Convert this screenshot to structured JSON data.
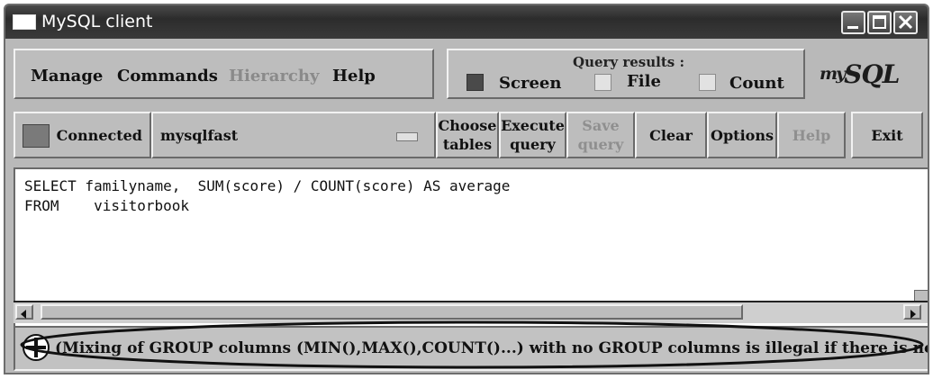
{
  "window": {
    "title": "MySQL client"
  },
  "menu": {
    "manage": "Manage",
    "commands": "Commands",
    "hierarchy": "Hierarchy",
    "help": "Help"
  },
  "query_results": {
    "label": "Query results :",
    "screen": "Screen",
    "file": "File",
    "count": "Count",
    "screen_checked": true,
    "file_checked": false,
    "count_checked": false
  },
  "logo": {
    "my": "my",
    "sql": "SQL"
  },
  "toolbar": {
    "connected": "Connected",
    "database": "mysqlfast",
    "choose_tables_1": "Choose",
    "choose_tables_2": "tables",
    "execute_query_1": "Execute",
    "execute_query_2": "query",
    "save_query_1": "Save",
    "save_query_2": "query",
    "clear": "Clear",
    "options": "Options",
    "help": "Help",
    "exit": "Exit"
  },
  "editor": {
    "line1": "SELECT familyname,  SUM(score) / COUNT(score) AS average",
    "line2": "FROM    visitorbook"
  },
  "status": {
    "message": "(Mixing of GROUP columns (MIN(),MAX(),COUNT()...) with no GROUP columns is illegal if there is no GROUP BY clause) Info"
  },
  "colors": {
    "window_bg": "#b9b9b9",
    "titlebar": "#2c2c2c",
    "status_checked": "#4a4a4a"
  },
  "icons": {
    "app": "window-icon",
    "minimize": "minimize-icon",
    "maximize": "maximize-icon",
    "close": "close-icon",
    "status": "crosshair-icon"
  }
}
